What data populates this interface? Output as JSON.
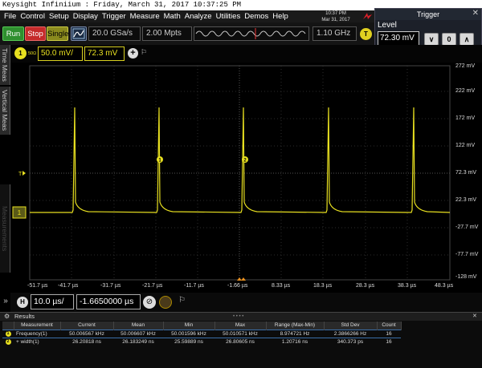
{
  "window": {
    "title": "Keysight Infiniium : Friday, March 31, 2017 10:37:25 PM"
  },
  "menu": [
    "File",
    "Control",
    "Setup",
    "Display",
    "Trigger",
    "Measure",
    "Math",
    "Analyze",
    "Utilities",
    "Demos",
    "Help"
  ],
  "clock": {
    "time": "10:37 PM",
    "date": "Mar 31, 2017"
  },
  "window_controls": {
    "minimize": "–",
    "restore": "▢",
    "close": "✕"
  },
  "toolbar": {
    "run": "Run",
    "stop": "Stop",
    "single": "Single",
    "sample_rate": "20.0 GSa/s",
    "memory_depth": "2.00 Mpts",
    "bandwidth": "1.10 GHz",
    "trigger_btn": "T"
  },
  "trigger": {
    "title": "Trigger",
    "close": "✕",
    "level_label": "Level",
    "level_value": "72.30 mV",
    "down": "∨",
    "zero": "0",
    "up": "∧"
  },
  "side_tabs": {
    "time_meas": "Time Meas",
    "vertical_meas": "Vertical Meas",
    "measurements": "Measurements"
  },
  "channel": {
    "number": "1",
    "impedance": "50Ω",
    "scale": "50.0 mV/",
    "offset": "72.3 mV",
    "add": "+"
  },
  "graticule": {
    "y_ticks": [
      "272 mV",
      "222 mV",
      "172 mV",
      "122 mV",
      "72.3 mV",
      "22.3 mV",
      "-27.7 mV",
      "-77.7 mV",
      "-128 mV"
    ],
    "x_ticks": [
      "-51.7 µs",
      "-41.7 µs",
      "-31.7 µs",
      "-21.7 µs",
      "-11.7 µs",
      "-1.66 µs",
      "8.33 µs",
      "18.3 µs",
      "28.3 µs",
      "38.3 µs",
      "48.3 µs"
    ],
    "marker_1": "1",
    "marker_2": "2",
    "trigger_level_marker": "T"
  },
  "horizontal": {
    "button": "H",
    "scale": "10.0 µs/",
    "position": "-1.6650000 µs"
  },
  "results": {
    "title": "Results",
    "columns": [
      "Measurement",
      "Current",
      "Mean",
      "Min",
      "Max",
      "Range (Max-Min)",
      "Std Dev",
      "Count"
    ],
    "rows": [
      {
        "index": "1",
        "cells": [
          "Frequency(1)",
          "50.006567 kHz",
          "50.006607 kHz",
          "50.001596 kHz",
          "50.010571 kHz",
          "8.974721 Hz",
          "2.3866266 Hz",
          "16"
        ]
      },
      {
        "index": "2",
        "cells": [
          "+ width(1)",
          "26.20818 ns",
          "26.183249 ns",
          "25.59889 ns",
          "26.80605 ns",
          "1.20716 ns",
          "340.373 ps",
          "16"
        ]
      }
    ]
  },
  "colors": {
    "trace": "#e8e020",
    "run": "#2f8f2f",
    "stop": "#c52a2a",
    "single": "#8a8a1e",
    "accent": "#3a6ea8"
  }
}
